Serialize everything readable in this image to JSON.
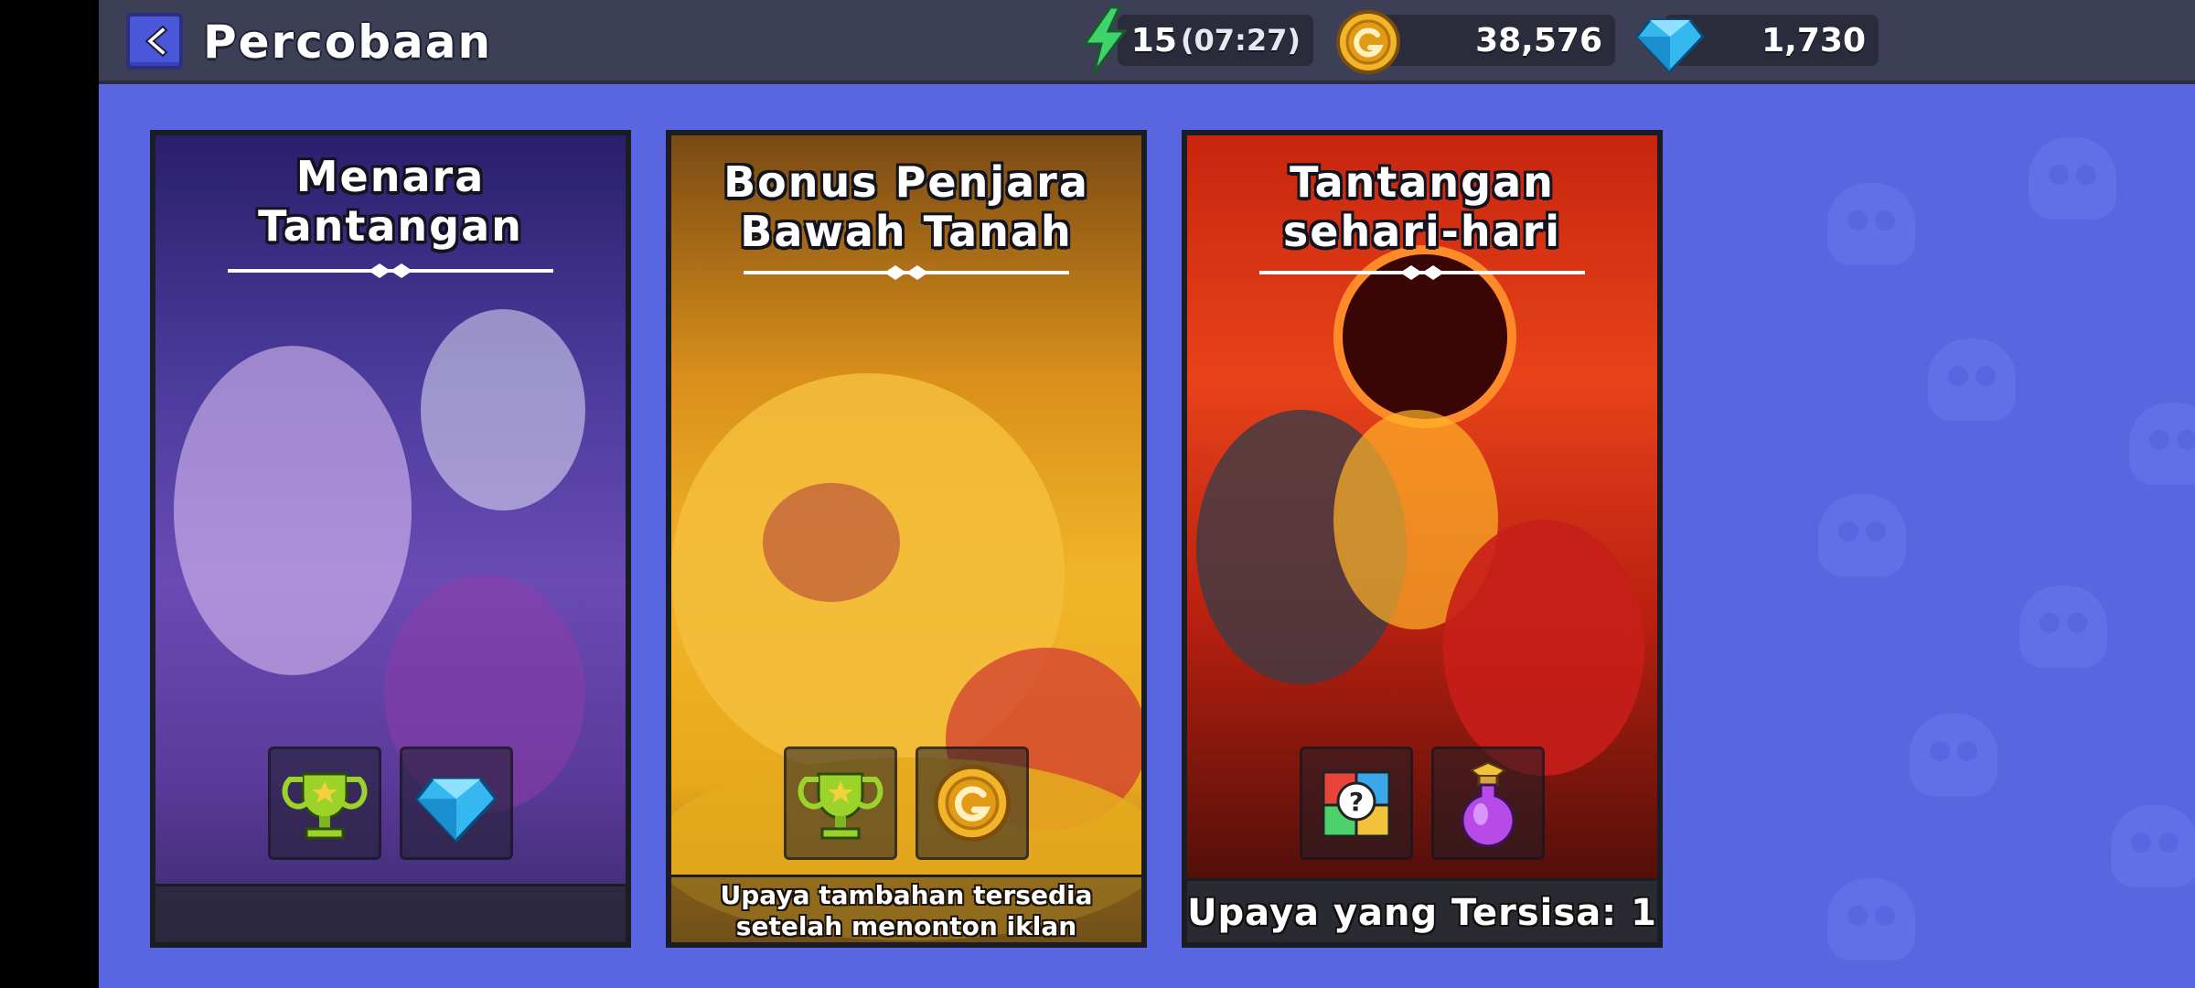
{
  "header": {
    "title": "Percobaan",
    "back_icon": "back-arrow-icon",
    "resources": {
      "energy": {
        "icon": "lightning-icon",
        "value": "15",
        "timer": "(07:27)"
      },
      "gold": {
        "icon": "gold-coin-icon",
        "value": "38,576"
      },
      "gems": {
        "icon": "diamond-icon",
        "value": "1,730"
      }
    }
  },
  "cards": [
    {
      "title_line1": "Menara",
      "title_line2": "Tantangan",
      "rewards": [
        "trophy-icon",
        "diamond-icon"
      ],
      "footer": ""
    },
    {
      "title_line1": "Bonus Penjara",
      "title_line2": "Bawah Tanah",
      "rewards": [
        "trophy-icon",
        "gold-coin-icon"
      ],
      "footer_line1": "Upaya tambahan tersedia",
      "footer_line2": "setelah menonton iklan"
    },
    {
      "title_line1": "Tantangan",
      "title_line2": "sehari-hari",
      "rewards": [
        "puzzle-piece-icon",
        "potion-flask-icon"
      ],
      "footer": "Upaya yang Tersisa: 1"
    }
  ],
  "colors": {
    "background": "#5a66e0",
    "topbar": "#3c3f55",
    "back_button": "#4a57d8",
    "gold": "#f2b52a",
    "gem": "#35b8f0",
    "energy": "#3fd46a"
  }
}
